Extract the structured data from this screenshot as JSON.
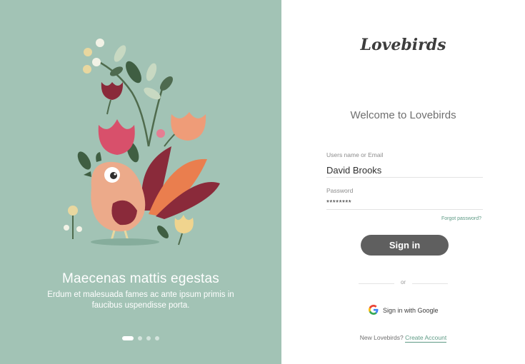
{
  "colors": {
    "panel_background": "#a2c3b5",
    "button_background": "#5f5f5f",
    "link_color": "#5f9b86"
  },
  "slide": {
    "title": "Maecenas mattis egestas",
    "subtitle": "Erdum et malesuada fames ac ante ipsum primis in faucibus uspendisse porta.",
    "dots_count": 4,
    "active_dot": 1
  },
  "brand": {
    "logo_text": "Lovebirds"
  },
  "form": {
    "welcome": "Welcome to Lovebirds",
    "username_label": "Users name or Email",
    "username_value": "David Brooks",
    "password_label": "Password",
    "password_value": "********",
    "forgot_label": "Forgot password?",
    "signin_label": "Sign in",
    "or_label": "or",
    "google_label": "Sign in with Google",
    "google_icon": "google-logo-icon"
  },
  "footer": {
    "prompt": "New Lovebirds?",
    "create_label": "Create Account"
  }
}
